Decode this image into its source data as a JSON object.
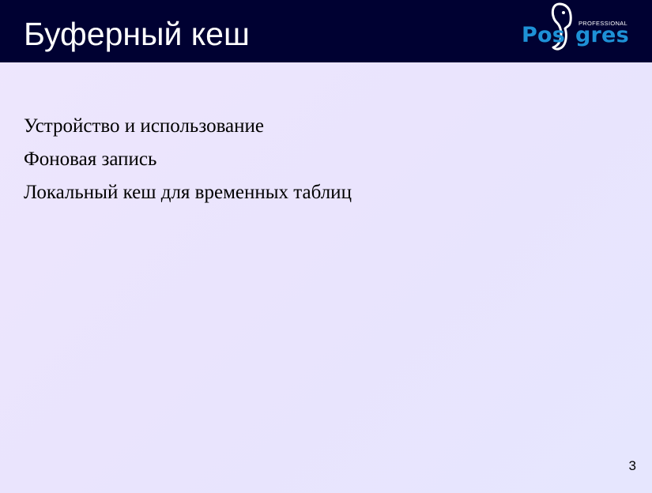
{
  "slide": {
    "title": "Буферный кеш",
    "page_number": "3"
  },
  "logo": {
    "tagline": "PROFESSIONAL",
    "word_part1": "Pos",
    "word_part2": "gres",
    "icon": "elephant-icon",
    "color": "#1e91d6"
  },
  "bullets": [
    {
      "text": "Устройство и использование"
    },
    {
      "text": "Фоновая запись"
    },
    {
      "text": "Локальный кеш для временных таблиц"
    }
  ],
  "colors": {
    "header_background": "#000132",
    "title_text": "#ffffff",
    "body_text": "#000000"
  }
}
